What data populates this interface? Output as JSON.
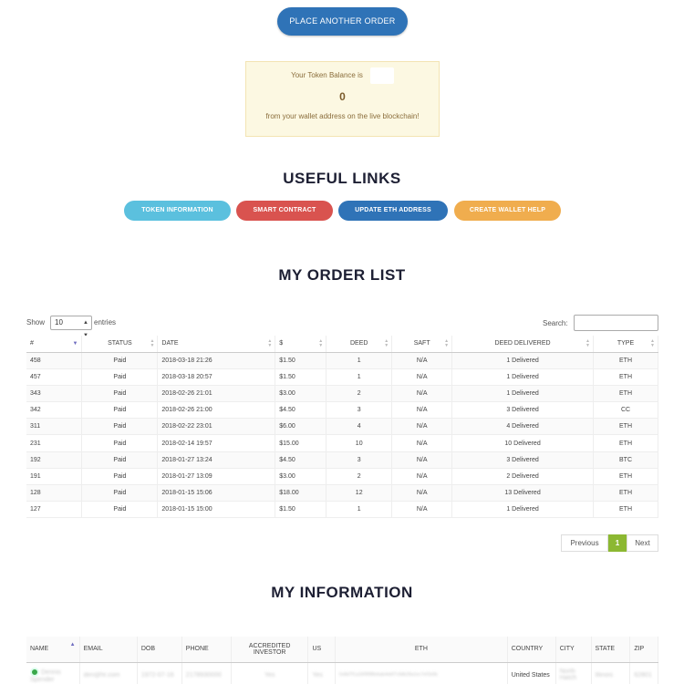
{
  "top_button": {
    "label": "PLACE ANOTHER ORDER"
  },
  "token": {
    "line1": "Your Token Balance is",
    "value": "0",
    "line3": "from your wallet address on the live blockchain!"
  },
  "useful_links": {
    "heading": "USEFUL LINKS",
    "buttons": [
      {
        "label": "TOKEN INFORMATION",
        "color": "#5bc0de"
      },
      {
        "label": "SMART CONTRACT",
        "color": "#d9534f"
      },
      {
        "label": "UPDATE ETH ADDRESS",
        "color": "#2f73b7"
      },
      {
        "label": "CREATE WALLET HELP",
        "color": "#f0ad4e"
      }
    ]
  },
  "orders": {
    "heading": "MY ORDER LIST",
    "show_label": "Show",
    "show_value": "10",
    "entries_label": "entries",
    "search_label": "Search:",
    "columns": [
      "#",
      "STATUS",
      "DATE",
      "$",
      "DEED",
      "SAFT",
      "DEED DELIVERED",
      "TYPE"
    ],
    "rows": [
      [
        "458",
        "Paid",
        "2018-03-18 21:26",
        "$1.50",
        "1",
        "N/A",
        "1 Delivered",
        "ETH"
      ],
      [
        "457",
        "Paid",
        "2018-03-18 20:57",
        "$1.50",
        "1",
        "N/A",
        "1 Delivered",
        "ETH"
      ],
      [
        "343",
        "Paid",
        "2018-02-26 21:01",
        "$3.00",
        "2",
        "N/A",
        "1 Delivered",
        "ETH"
      ],
      [
        "342",
        "Paid",
        "2018-02-26 21:00",
        "$4.50",
        "3",
        "N/A",
        "3 Delivered",
        "CC"
      ],
      [
        "311",
        "Paid",
        "2018-02-22 23:01",
        "$6.00",
        "4",
        "N/A",
        "4 Delivered",
        "ETH"
      ],
      [
        "231",
        "Paid",
        "2018-02-14 19:57",
        "$15.00",
        "10",
        "N/A",
        "10 Delivered",
        "ETH"
      ],
      [
        "192",
        "Paid",
        "2018-01-27 13:24",
        "$4.50",
        "3",
        "N/A",
        "3 Delivered",
        "BTC"
      ],
      [
        "191",
        "Paid",
        "2018-01-27 13:09",
        "$3.00",
        "2",
        "N/A",
        "2 Delivered",
        "ETH"
      ],
      [
        "128",
        "Paid",
        "2018-01-15 15:06",
        "$18.00",
        "12",
        "N/A",
        "13 Delivered",
        "ETH"
      ],
      [
        "127",
        "Paid",
        "2018-01-15 15:00",
        "$1.50",
        "1",
        "N/A",
        "1 Delivered",
        "ETH"
      ]
    ],
    "pagination": {
      "previous": "Previous",
      "current": "1",
      "next": "Next"
    }
  },
  "info": {
    "heading": "MY INFORMATION",
    "columns": [
      "NAME",
      "EMAIL",
      "DOB",
      "PHONE",
      "ACCREDITED INVESTOR",
      "US",
      "ETH",
      "COUNTRY",
      "CITY",
      "STATE",
      "ZIP"
    ],
    "row": {
      "name": "Dennis Spender",
      "email": "den@hr.com",
      "dob": "1972-07-16",
      "phone": "2178930000",
      "accredited": "Yes",
      "us": "Yes",
      "eth": "0x8d7f1a16f9f9f8ebab4ebf7c9db28a1ec7ef1b0b",
      "country": "United States",
      "city": "North Hatch",
      "state": "Illinois",
      "zip": "62801"
    }
  }
}
